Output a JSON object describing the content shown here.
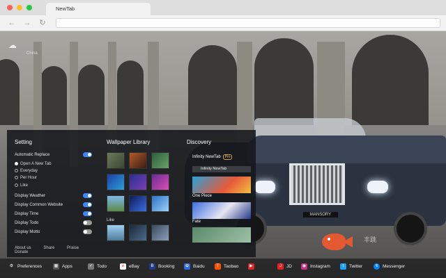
{
  "browser": {
    "tab_title": "NewTab",
    "nav_back_icon": "arrow-left-icon",
    "nav_forward_icon": "arrow-right-icon",
    "nav_reload_icon": "reload-icon"
  },
  "weather": {
    "icon": "cloud-icon",
    "city": "China"
  },
  "setting": {
    "title": "Setting",
    "auto_replace_label": "Automatic Replace",
    "auto_replace_on": true,
    "options": [
      {
        "label": "Open A New Tab",
        "selected": true
      },
      {
        "label": "Everyday",
        "selected": false
      },
      {
        "label": "Per Hour",
        "selected": false
      },
      {
        "label": "Like",
        "selected": false
      }
    ],
    "toggles": [
      {
        "label": "Display Weather",
        "on": true
      },
      {
        "label": "Display Common Website",
        "on": true
      },
      {
        "label": "Display Time",
        "on": true
      },
      {
        "label": "Display Todo",
        "on": false
      },
      {
        "label": "Display Motto",
        "on": false
      }
    ],
    "footer": [
      "About us",
      "Share",
      "Praise",
      "Donate"
    ]
  },
  "wallpaper_library": {
    "title": "Wallpaper Library",
    "like_label": "Like"
  },
  "discovery": {
    "title": "Discovery",
    "app_name": "Infinity NewTab",
    "badge": "Pro",
    "input_value": "Infinity NewTab",
    "items": [
      {
        "caption": "One Piece"
      },
      {
        "caption": "Fate"
      }
    ]
  },
  "car_plate": "MANSORY",
  "watermark": "丰跳",
  "bottom_bar": [
    {
      "label": "Preferences",
      "icon": "gear-icon",
      "color": "#555555"
    },
    {
      "label": "Apps",
      "icon": "grid-icon",
      "color": "#555555"
    },
    {
      "label": "Todo",
      "icon": "check-icon",
      "color": "#777777"
    },
    {
      "label": "eBay",
      "icon": "ebay-icon",
      "color": "#ffffff"
    },
    {
      "label": "Booking",
      "icon": "booking-icon",
      "color": "#1f3b8a"
    },
    {
      "label": "Baidu",
      "icon": "baidu-icon",
      "color": "#2f6be0"
    },
    {
      "label": "Taobao",
      "icon": "taobao-icon",
      "color": "#ff5000"
    },
    {
      "label": "",
      "icon": "tv-icon",
      "color": "#e02424"
    },
    {
      "label": "JD",
      "icon": "jd-icon",
      "color": "#e02424"
    },
    {
      "label": "Instagram",
      "icon": "instagram-icon",
      "color": "#c13584"
    },
    {
      "label": "Twitter",
      "icon": "twitter-icon",
      "color": "#1da1f2"
    },
    {
      "label": "Messenger",
      "icon": "messenger-icon",
      "color": "#0084ff"
    }
  ]
}
